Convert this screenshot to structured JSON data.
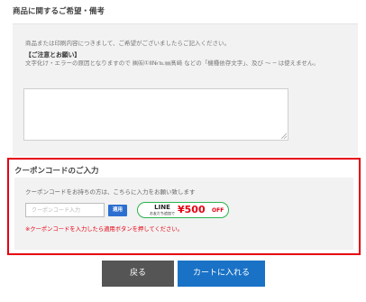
{
  "notes": {
    "title": "商品に関するご希望・備考",
    "intro": "商品または印刷内容につきまして、ご希望がございましたらご記入ください。",
    "caution_heading": "【ご注意とお願い】",
    "caution_text": "文字化け・エラーの原因となりますので ㈱㈲①Ⅱ№℡㎜髙﨑 などの「機種依存文字」、及び ～ ─ は使えません。",
    "textarea_value": ""
  },
  "coupon": {
    "title": "クーポンコードのご入力",
    "description": "クーポンコードをお持ちの方は、こちらに入力をお願い致します",
    "input_placeholder": "クーポンコード入力",
    "input_value": "",
    "apply_label": "適用",
    "line_badge": {
      "line_text": "LINE",
      "sub_text": "お友だち追加で",
      "amount": "¥500",
      "off": "OFF"
    },
    "note": "※クーポンコードを入力したら適用ボタンを押してください。"
  },
  "actions": {
    "back_label": "戻る",
    "cart_label": "カートに入れる"
  },
  "colors": {
    "highlight_border": "#e60012",
    "primary_blue": "#1a72c6",
    "apply_blue": "#2d6fd0",
    "back_gray": "#555555",
    "line_green": "#2bb34b"
  }
}
